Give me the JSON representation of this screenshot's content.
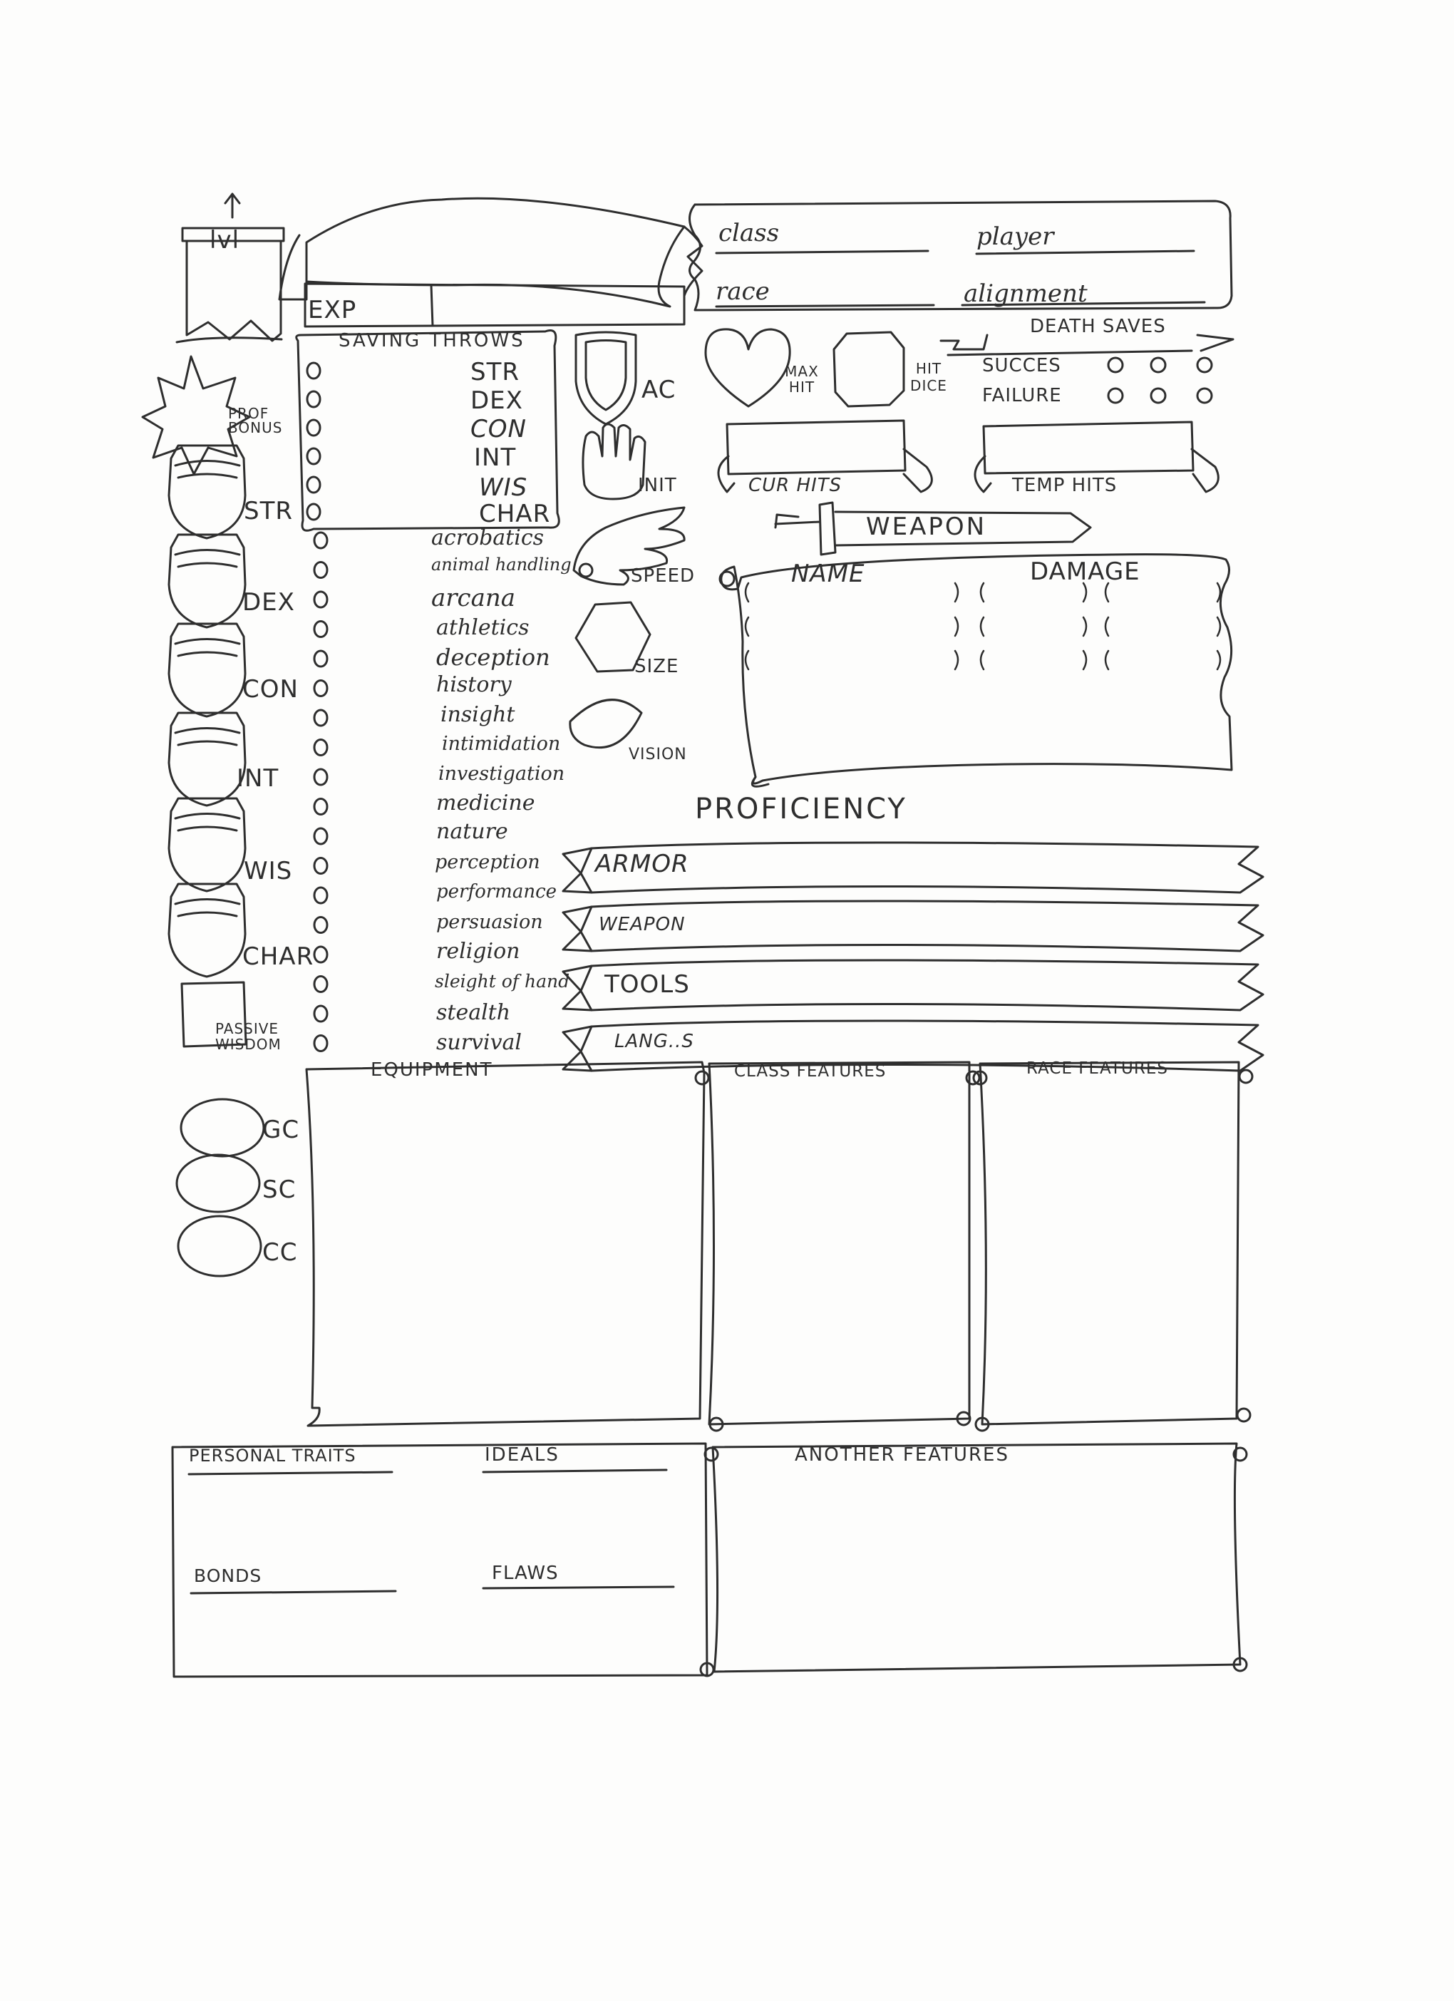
{
  "header": {
    "level_label": "lvl",
    "exp_label": "EXP",
    "class_label": "class",
    "player_label": "player",
    "race_label": "race",
    "alignment_label": "alignment"
  },
  "left_column": {
    "prof_bonus_label": "PROF BONUS",
    "abilities": [
      "STR",
      "DEX",
      "CON",
      "INT",
      "WIS",
      "CHAR"
    ],
    "passive_wisdom_label": "PASSIVE WISDOM",
    "coins": [
      "GC",
      "SC",
      "CC"
    ]
  },
  "saving_throws": {
    "title": "SAVING THROWS",
    "items": [
      "STR",
      "DEX",
      "CON",
      "INT",
      "WIS",
      "CHAR"
    ]
  },
  "skills": [
    "acrobatics",
    "animal handling",
    "arcana",
    "athletics",
    "deception",
    "history",
    "insight",
    "intimidation",
    "investigation",
    "medicine",
    "nature",
    "perception",
    "performance",
    "persuasion",
    "religion",
    "sleight of hand",
    "stealth",
    "survival"
  ],
  "combat": {
    "ac_label": "AC",
    "max_hit_label": "MAX HIT",
    "hit_dice_label": "HIT DICE",
    "init_label": "INIT",
    "speed_label": "SPEED",
    "size_label": "SIZE",
    "vision_label": "VISION",
    "cur_hits_label": "CUR HITS",
    "temp_hits_label": "TEMP HITS"
  },
  "death_saves": {
    "title": "DEATH SAVES",
    "success_label": "SUCCES",
    "failure_label": "FAILURE"
  },
  "weapon_table": {
    "title": "WEAPON",
    "name_col": "NAME",
    "damage_col": "DAMAGE"
  },
  "proficiency": {
    "title": "PROFICIENCY",
    "rows": [
      "ARMOR",
      "WEAPON",
      "TOOLS",
      "LANG..S"
    ]
  },
  "panels": {
    "equipment": "EQUIPMENT",
    "class_features": "CLASS FEATURES",
    "race_features": "RACE FEATURES",
    "personal_traits": "PERSONAL TRAITS",
    "ideals": "IDEALS",
    "bonds": "BONDS",
    "flaws": "FLAWS",
    "another_features": "ANOTHER FEATURES"
  },
  "style": {
    "ink": "#2e2e2e",
    "paper": "#fdfdfc"
  }
}
